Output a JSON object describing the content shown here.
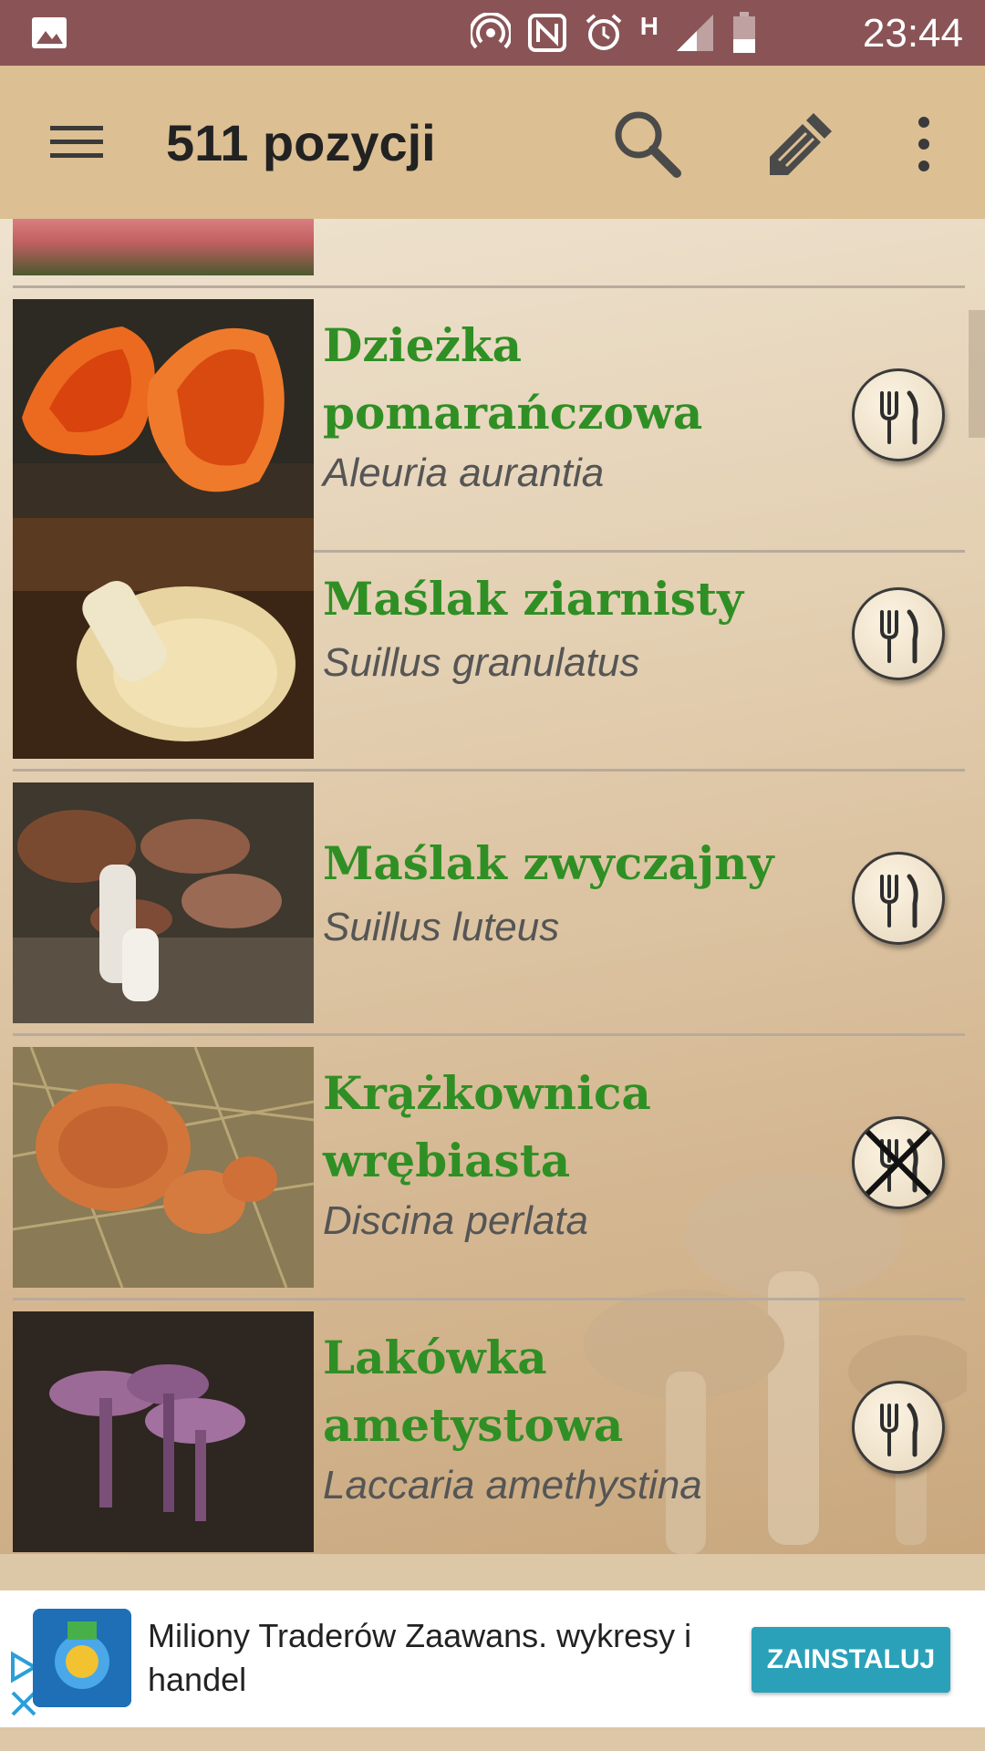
{
  "status_bar": {
    "time": "23:44",
    "network_type": "H",
    "icons": [
      "image-icon",
      "hotspot-icon",
      "nfc-icon",
      "alarm-icon",
      "signal-icon",
      "battery-icon"
    ]
  },
  "app_bar": {
    "title": "511 pozycji",
    "icons": [
      "menu-icon",
      "search-icon",
      "edit-icon",
      "more-vert-icon"
    ]
  },
  "list": {
    "items": [
      {
        "name": "Dzieżka pomarańczowa",
        "name_lines": [
          "Dzieżka",
          "pomarańczowa"
        ],
        "latin": "Aleuria aurantia",
        "edible": true
      },
      {
        "name": "Maślak ziarnisty",
        "name_lines": [
          "Maślak ziarnisty"
        ],
        "latin": "Suillus granulatus",
        "edible": true
      },
      {
        "name": "Maślak zwyczajny",
        "name_lines": [
          "Maślak zwyczajny"
        ],
        "latin": "Suillus luteus",
        "edible": true
      },
      {
        "name": "Krążkownica wrębiasta",
        "name_lines": [
          "Krążkownica",
          "wrębiasta"
        ],
        "latin": "Discina perlata",
        "edible": false
      },
      {
        "name": "Lakówka ametystowa",
        "name_lines": [
          "Lakówka",
          "ametystowa"
        ],
        "latin": "Laccaria amethystina",
        "edible": true
      }
    ]
  },
  "ad": {
    "text": "Miliony Traderów Zaawans. wykresy i handel",
    "button_label": "ZAINSTALUJ"
  },
  "colors": {
    "status_bar": "#8a5457",
    "app_bar": "#dcbf92",
    "name_green": "#2f8f24",
    "install_button": "#2aa1b9"
  }
}
